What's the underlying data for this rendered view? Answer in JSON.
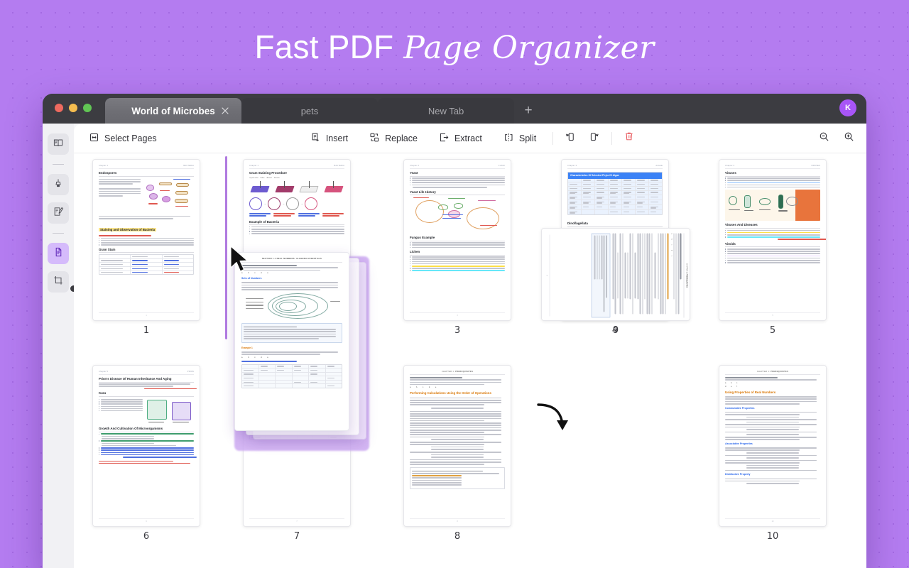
{
  "hero": {
    "title_part_a": "Fast PDF",
    "title_part_b": "Page Organizer"
  },
  "window": {
    "tabs": [
      {
        "label": "World of Microbes",
        "active": true,
        "closable": true
      },
      {
        "label": "pets",
        "active": false,
        "closable": false
      },
      {
        "label": "New Tab",
        "active": false,
        "closable": false
      }
    ],
    "new_tab_label": "+",
    "avatar_initial": "K",
    "traffic_lights": [
      "close",
      "minimize",
      "maximize"
    ]
  },
  "sidebar": {
    "items": [
      {
        "name": "reader-view",
        "icon": "book-icon",
        "active": false
      },
      {
        "name": "highlight-tool",
        "icon": "highlighter-icon",
        "active": false
      },
      {
        "name": "annotate-tool",
        "icon": "pen-note-icon",
        "active": false
      },
      {
        "name": "organize-pages",
        "icon": "pages-icon",
        "active": true
      },
      {
        "name": "crop-tool",
        "icon": "crop-icon",
        "active": false
      }
    ]
  },
  "toolbar": {
    "select_pages_label": "Select Pages",
    "select_pages_icon": "select-pages-icon",
    "actions": [
      {
        "label": "Insert",
        "icon": "insert-icon"
      },
      {
        "label": "Replace",
        "icon": "replace-icon"
      },
      {
        "label": "Extract",
        "icon": "extract-icon"
      },
      {
        "label": "Split",
        "icon": "split-icon"
      }
    ],
    "rotate_left_icon": "rotate-left-icon",
    "rotate_right_icon": "rotate-right-icon",
    "delete_icon": "trash-icon",
    "zoom_out_icon": "zoom-out-icon",
    "zoom_in_icon": "zoom-in-icon",
    "accent_color": "#a855f7",
    "danger_color": "#e5484d"
  },
  "pages": [
    {
      "number": "1",
      "header_left": "Chapter 1",
      "header_right": "BACTERIA",
      "title": "Endospores",
      "sections": [
        "Endospores",
        "Staining and Observation of Bacteria",
        "Gram Stain"
      ],
      "footer": "1",
      "rotated": false
    },
    {
      "number": "2",
      "header_left": "Chapter 1",
      "header_right": "BACTERIA",
      "title": "Gram Staining Procedure",
      "sections": [
        "Gram Staining Procedure",
        "Example of Bacteria"
      ],
      "legend": [
        "Crystal violet",
        "Iodine",
        "Alcohol",
        "Safranin"
      ],
      "footer": "2",
      "rotated": false
    },
    {
      "number": "3",
      "header_left": "Chapter 2",
      "header_right": "FUNGI",
      "title": "Yeast",
      "sections": [
        "Yeast",
        "Yeast Life History",
        "Fungus Example",
        "Lichen"
      ],
      "footer": "3",
      "rotated": false
    },
    {
      "number": "4",
      "header_left": "Chapter 3",
      "header_right": "ALGAE",
      "title": "Characteristics Of Selected Phyla Of Algae",
      "sections": [
        "Characteristics Of Selected Phyla Of Algae",
        "Dinoflagellata"
      ],
      "footer": "4",
      "rotated": false
    },
    {
      "number": "5",
      "header_left": "Chapter 4",
      "header_right": "VIRUSES",
      "title": "Viruses",
      "sections": [
        "Viruses",
        "Viruses And Diseases",
        "Viroids"
      ],
      "footer": "5",
      "rotated": false
    },
    {
      "number": "6",
      "header_left": "Chapter 5",
      "header_right": "PRION",
      "title": "Prion's Disease Of Human Inheritance And Aging",
      "sections": [
        "Prion's Disease Of Human Inheritance And Aging",
        "Kuru",
        "Growth And Cultivation Of Microorganisms"
      ],
      "footer": "6",
      "rotated": false
    },
    {
      "number": "7",
      "header_left": "",
      "header_right": "",
      "title": "Real Numbers: Algebra Essentials",
      "sections": [
        "Sets of Numbers",
        "Example 1"
      ],
      "footer": "7",
      "rotated": false
    },
    {
      "number": "8",
      "header_left": "CHAPTER 1:",
      "header_right": "PREREQUISITES",
      "title": "Performing Calculations Using the Order of Operations",
      "sections": [
        "Performing Calculations Using the Order of Operations",
        "Order of Operations"
      ],
      "footer": "8",
      "rotated": false
    },
    {
      "number": "9",
      "header_left": "CHAPTER 1:",
      "header_right": "PREREQUISITES",
      "title": "Performing Calculations Using the Order of Operations",
      "sections": [
        "Performing Calculations Using the Order of Operations"
      ],
      "footer": "9",
      "rotated": true
    },
    {
      "number": "10",
      "header_left": "CHAPTER 1:",
      "header_right": "PREREQUISITES",
      "title": "Using Properties of Real Numbers",
      "sections": [
        "Using Properties of Real Numbers",
        "Commutative Properties",
        "Associative Properties",
        "Distributive Property"
      ],
      "footer": "10",
      "rotated": false
    }
  ],
  "drag_state": {
    "dragging_page": "7",
    "drop_indicator_color": "#b07ae0",
    "cursor": "arrow-cursor",
    "stack_page_title": "SECTION 1.1  REAL NUMBERS: ALGEBRA ESSENTIALS"
  }
}
